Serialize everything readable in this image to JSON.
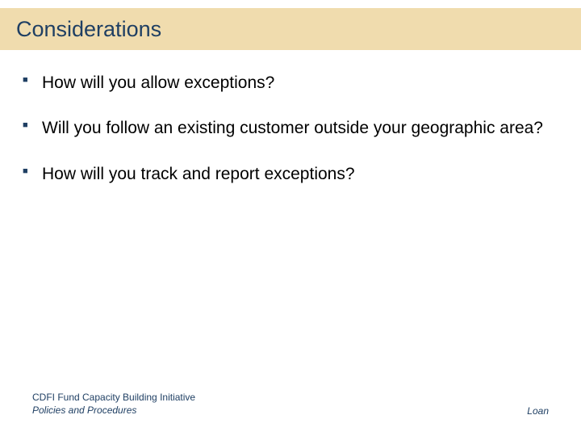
{
  "header": {
    "title": "Considerations"
  },
  "bullets": [
    "How will you allow exceptions?",
    "Will you follow an existing customer outside your geographic area?",
    "How will you track and report exceptions?"
  ],
  "footer": {
    "left_line1": "CDFI Fund Capacity Building Initiative",
    "left_line2": "Policies and Procedures",
    "right": "Loan"
  }
}
